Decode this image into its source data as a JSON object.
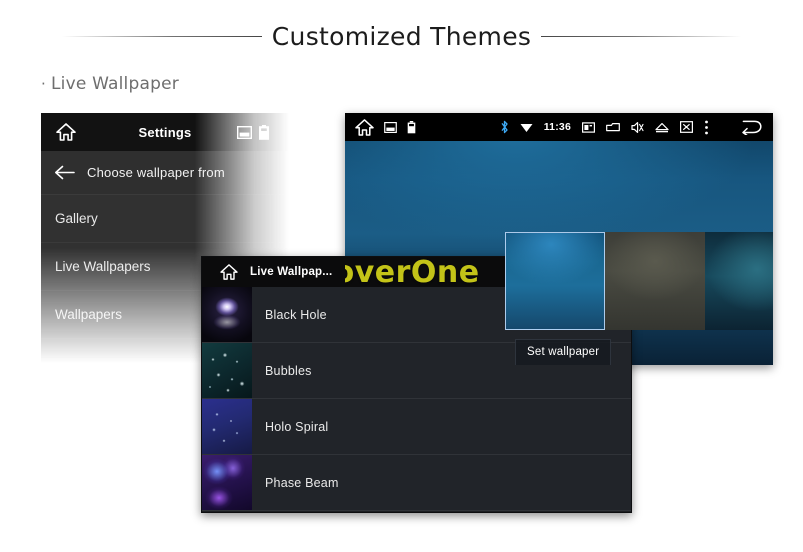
{
  "header": {
    "title": "Customized Themes",
    "section_label": "Live Wallpaper",
    "section_bullet": "·"
  },
  "settings_panel": {
    "home_icon": "home-icon",
    "title": "Settings",
    "header_icons": [
      "picture-icon",
      "battery-icon"
    ],
    "back_icon": "back-arrow-icon",
    "subtitle": "Choose wallpaper from",
    "rows": [
      {
        "label": "Gallery"
      },
      {
        "label": "Live Wallpapers"
      },
      {
        "label": "Wallpapers"
      }
    ]
  },
  "live_wallpapers_panel": {
    "home_icon": "home-icon",
    "title": "Live Wallpap...",
    "rows": [
      {
        "label": "Black Hole",
        "thumb": "black-hole-thumb"
      },
      {
        "label": "Bubbles",
        "thumb": "bubbles-thumb"
      },
      {
        "label": "Holo Spiral",
        "thumb": "holo-spiral-thumb"
      },
      {
        "label": "Phase Beam",
        "thumb": "phase-beam-thumb"
      }
    ]
  },
  "preview_panel": {
    "statusbar": {
      "left_icons": [
        "home-icon",
        "picture-icon",
        "battery-icon"
      ],
      "bluetooth_icon": "bluetooth-icon",
      "wifi_icon": "wifi-icon",
      "clock": "11:36",
      "right_icons": [
        "sd-card-icon",
        "folder-icon",
        "mute-speaker-icon",
        "eject-icon",
        "close-box-icon",
        "overflow-menu-icon"
      ],
      "back_icon": "back-arrow-icon"
    },
    "thumbnails": [
      {
        "name": "wallpaper-thumb-blue",
        "selected": true
      },
      {
        "name": "wallpaper-thumb-grey",
        "selected": false
      },
      {
        "name": "wallpaper-thumb-teal",
        "selected": false
      }
    ],
    "set_wallpaper_label": "Set wallpaper"
  },
  "watermark": {
    "text": "RoverOne",
    "color": "#c3c318"
  }
}
